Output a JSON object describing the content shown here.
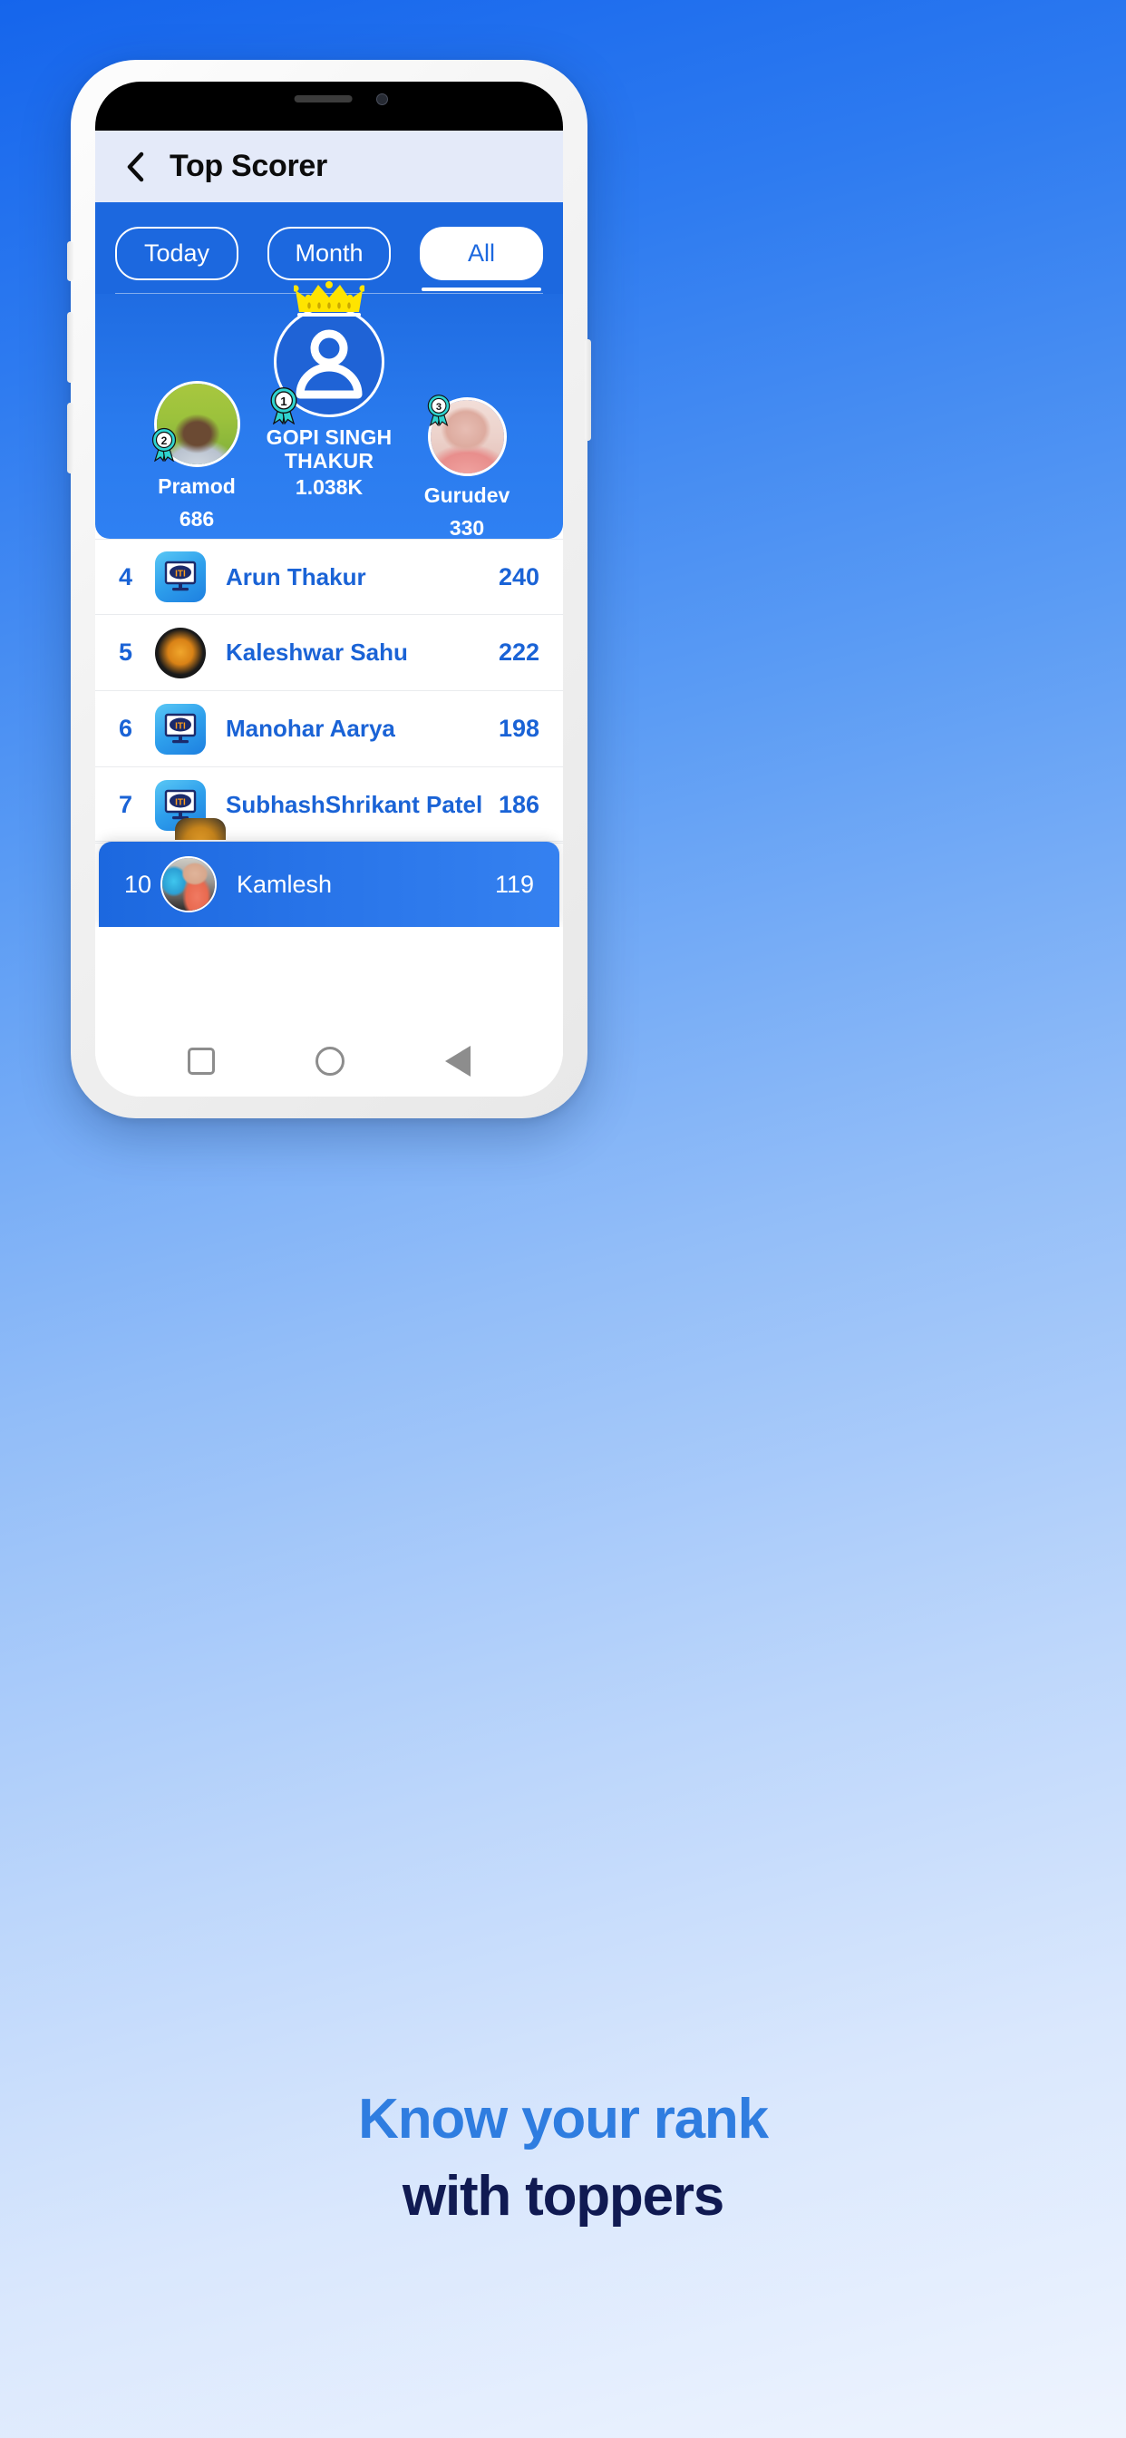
{
  "header": {
    "title": "Top Scorer",
    "back_icon": "chevron-left-icon"
  },
  "tabs": [
    {
      "label": "Today",
      "active": false
    },
    {
      "label": "Month",
      "active": false
    },
    {
      "label": "All",
      "active": true
    }
  ],
  "podium": {
    "first": {
      "rank": "1",
      "name": "GOPI SINGH THAKUR",
      "score": "1.038K",
      "crown_icon": "crown-icon",
      "avatar_icon": "person-placeholder-icon",
      "badge_icon": "medal-ribbon-icon"
    },
    "second": {
      "rank": "2",
      "name": "Pramod",
      "score": "686",
      "badge_icon": "medal-ribbon-icon"
    },
    "third": {
      "rank": "3",
      "name": "Gurudev",
      "score": "330",
      "badge_icon": "medal-ribbon-icon"
    }
  },
  "list": {
    "rows": [
      {
        "rank": "4",
        "name": "Arun Thakur",
        "score": "240",
        "avatar": "iti-app-icon"
      },
      {
        "rank": "5",
        "name": "Kaleshwar Sahu",
        "score": "222",
        "avatar": "deity-photo"
      },
      {
        "rank": "6",
        "name": "Manohar Aarya",
        "score": "198",
        "avatar": "iti-app-icon"
      },
      {
        "rank": "7",
        "name": "SubhashShrikant Patel",
        "score": "186",
        "avatar": "iti-app-icon"
      }
    ],
    "current_user": {
      "rank": "10",
      "name": "Kamlesh",
      "score": "119",
      "avatar": "user-photo"
    }
  },
  "nav": {
    "recents_icon": "square-icon",
    "home_icon": "circle-icon",
    "back_icon": "triangle-icon"
  },
  "caption": {
    "line1": "Know your rank",
    "line2": "with toppers"
  },
  "colors": {
    "brand_blue": "#1c68df",
    "accent_blue": "#2f7de0",
    "header_bg": "#e4eaf9",
    "crown_yellow": "#ffe400",
    "badge_teal": "#2fd3cf",
    "caption_navy": "#101a52"
  }
}
